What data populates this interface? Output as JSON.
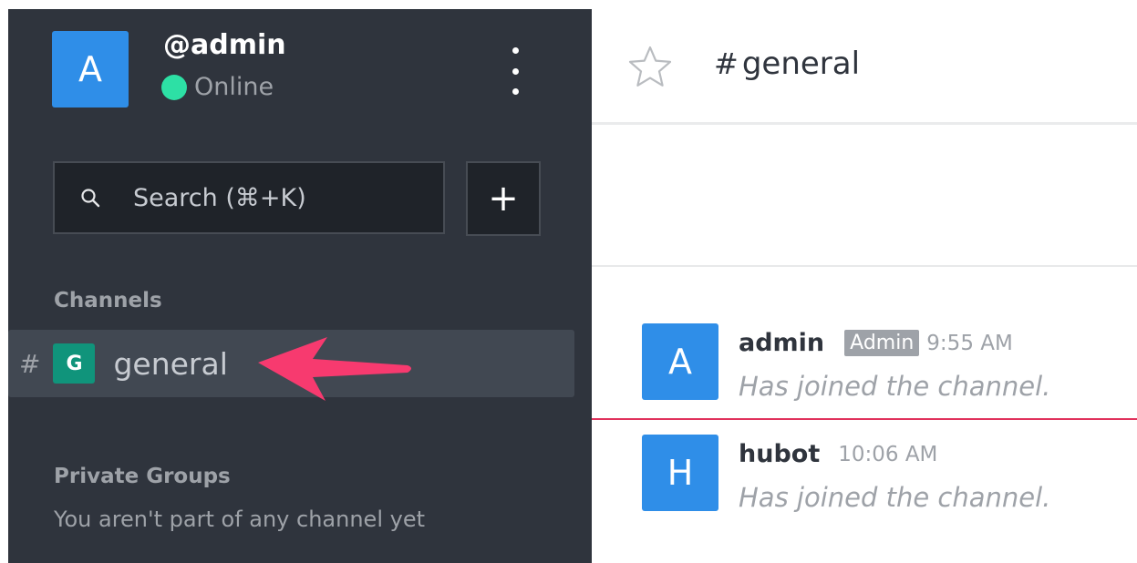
{
  "user": {
    "username": "@admin",
    "avatar_initial": "A",
    "status": "Online",
    "status_color": "#2de0a5"
  },
  "search": {
    "placeholder": "Search (⌘+K)"
  },
  "add_button": {
    "label": "+"
  },
  "channels": {
    "title": "Channels",
    "items": [
      {
        "hash": "#",
        "badge": "G",
        "name": "general",
        "active": true
      }
    ]
  },
  "private_groups": {
    "title": "Private Groups",
    "empty_text": "You aren't part of any channel yet"
  },
  "room": {
    "hash": "#",
    "name": "general"
  },
  "messages": [
    {
      "avatar_initial": "A",
      "user": "admin",
      "role": "Admin",
      "time": "9:55 AM",
      "body": "Has joined the channel."
    },
    {
      "avatar_initial": "H",
      "user": "hubot",
      "time": "10:06 AM",
      "body": "Has joined the channel."
    }
  ],
  "colors": {
    "sidebar_bg": "#2f343d",
    "avatar_blue": "#2f8ee8",
    "channel_badge": "#10947b",
    "active_row": "#414852",
    "annotation_arrow": "#f73a6f",
    "unread_line": "#e0325c"
  }
}
